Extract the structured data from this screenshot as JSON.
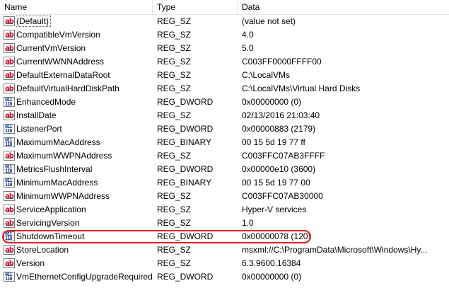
{
  "columns": {
    "name": "Name",
    "type": "Type",
    "data": "Data"
  },
  "rows": [
    {
      "icon": "ab",
      "name": "(Default)",
      "type": "REG_SZ",
      "data": "(value not set)"
    },
    {
      "icon": "ab",
      "name": "CompatibleVmVersion",
      "type": "REG_SZ",
      "data": "4.0"
    },
    {
      "icon": "ab",
      "name": "CurrentVmVersion",
      "type": "REG_SZ",
      "data": "5.0"
    },
    {
      "icon": "ab",
      "name": "CurrentWWNNAddress",
      "type": "REG_SZ",
      "data": "C003FF0000FFFF00"
    },
    {
      "icon": "ab",
      "name": "DefaultExternalDataRoot",
      "type": "REG_SZ",
      "data": "C:\\LocalVMs"
    },
    {
      "icon": "ab",
      "name": "DefaultVirtualHardDiskPath",
      "type": "REG_SZ",
      "data": "C:\\LocalVMs\\Virtual Hard Disks"
    },
    {
      "icon": "bin",
      "name": "EnhancedMode",
      "type": "REG_DWORD",
      "data": "0x00000000 (0)"
    },
    {
      "icon": "ab",
      "name": "InstallDate",
      "type": "REG_SZ",
      "data": "02/13/2016 21:03:40"
    },
    {
      "icon": "bin",
      "name": "ListenerPort",
      "type": "REG_DWORD",
      "data": "0x00000883 (2179)"
    },
    {
      "icon": "bin",
      "name": "MaximumMacAddress",
      "type": "REG_BINARY",
      "data": "00 15 5d 19 77 ff"
    },
    {
      "icon": "ab",
      "name": "MaximumWWPNAddress",
      "type": "REG_SZ",
      "data": "C003FFC07AB3FFFF"
    },
    {
      "icon": "bin",
      "name": "MetricsFlushInterval",
      "type": "REG_DWORD",
      "data": "0x00000e10 (3600)"
    },
    {
      "icon": "bin",
      "name": "MinimumMacAddress",
      "type": "REG_BINARY",
      "data": "00 15 5d 19 77 00"
    },
    {
      "icon": "ab",
      "name": "MinimumWWPNAddress",
      "type": "REG_SZ",
      "data": "C003FFC07AB30000"
    },
    {
      "icon": "ab",
      "name": "ServiceApplication",
      "type": "REG_SZ",
      "data": "Hyper-V services"
    },
    {
      "icon": "ab",
      "name": "ServicingVersion",
      "type": "REG_SZ",
      "data": "1.0"
    },
    {
      "icon": "bin",
      "name": "ShutdownTimeout",
      "type": "REG_DWORD",
      "data": "0x00000078 (120)"
    },
    {
      "icon": "ab",
      "name": "StoreLocation",
      "type": "REG_SZ",
      "data": "msxml://C:\\ProgramData\\Microsoft\\Windows\\Hy..."
    },
    {
      "icon": "ab",
      "name": "Version",
      "type": "REG_SZ",
      "data": "6.3.9600.16384"
    },
    {
      "icon": "bin",
      "name": "VmEthernetConfigUpgradeRequired",
      "type": "REG_DWORD",
      "data": "0x00000000 (0)"
    }
  ],
  "highlight_color": "#d81f26"
}
